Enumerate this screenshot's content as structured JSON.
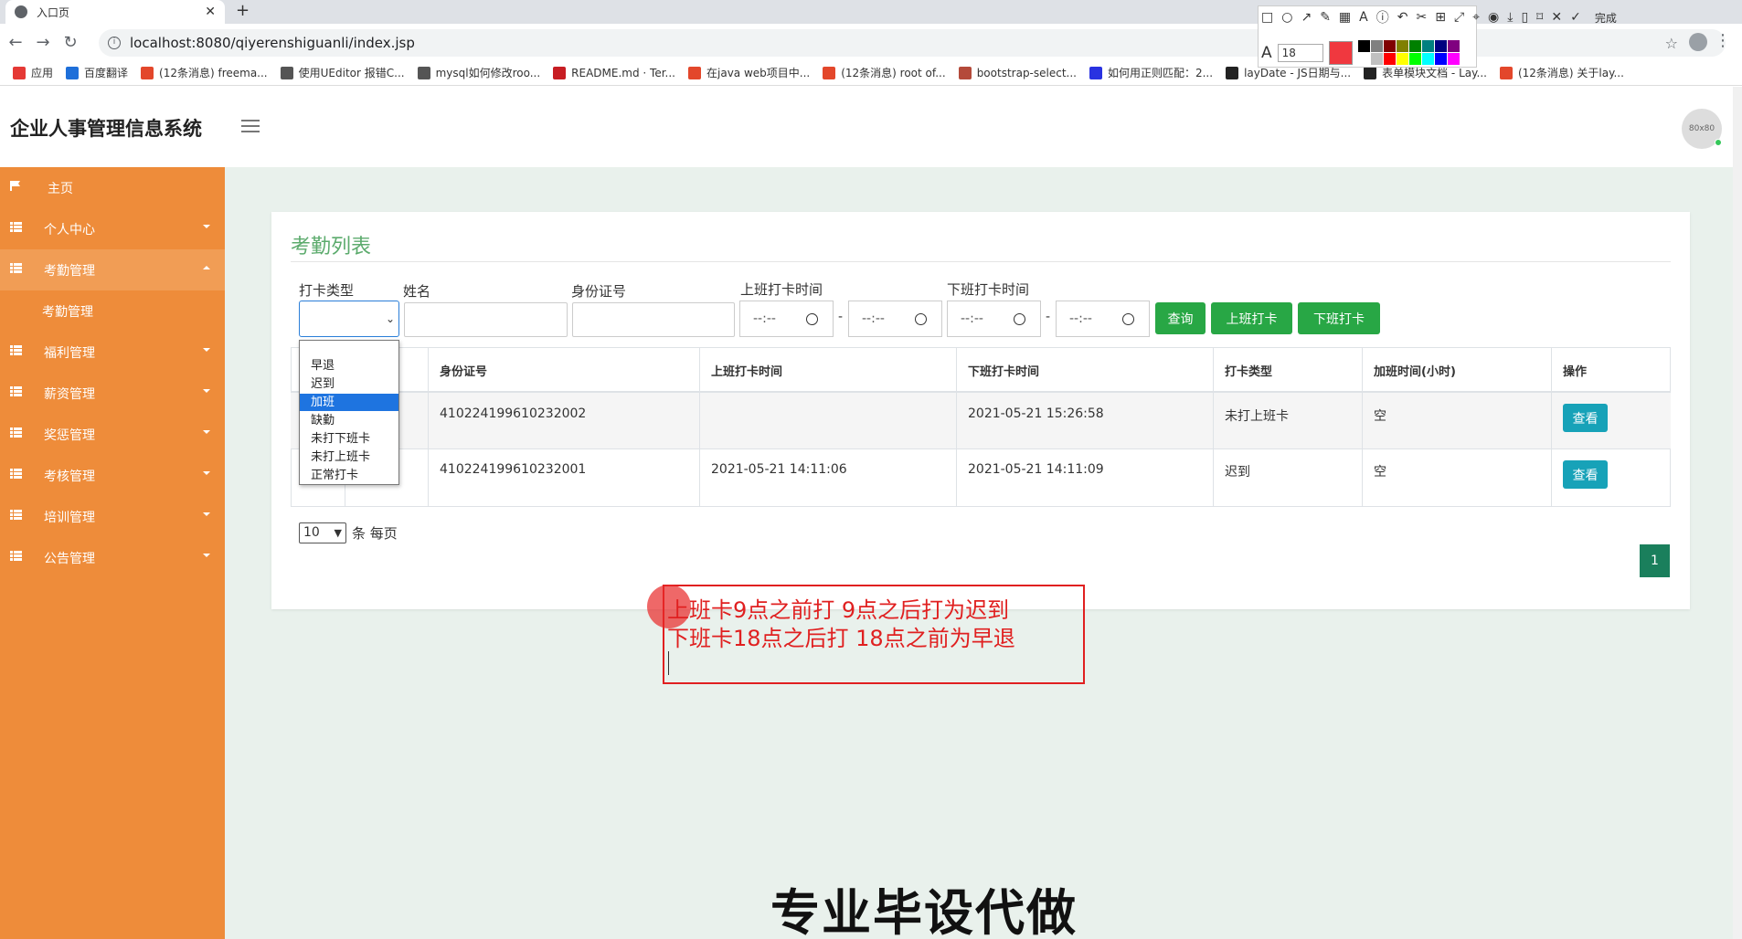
{
  "browser": {
    "tab_title": "入口页",
    "tab_close": "✕",
    "new_tab": "+",
    "url": "localhost:8080/qiyerenshiguanli/index.jsp",
    "bookmarks": [
      {
        "label": "应用",
        "color": "#e53935"
      },
      {
        "label": "百度翻译",
        "color": "#1e6fd9"
      },
      {
        "label": "(12条消息) freema...",
        "color": "#e3472b"
      },
      {
        "label": "使用UEditor 报错C...",
        "color": "#555555"
      },
      {
        "label": "mysql如何修改roo...",
        "color": "#555555"
      },
      {
        "label": "README.md · Ter...",
        "color": "#c71d23"
      },
      {
        "label": "在java web项目中...",
        "color": "#e3472b"
      },
      {
        "label": "(12条消息) root of...",
        "color": "#e3472b"
      },
      {
        "label": "bootstrap-select...",
        "color": "#b44a3a"
      },
      {
        "label": "如何用正则匹配：2...",
        "color": "#2932e1"
      },
      {
        "label": "layDate - JS日期与...",
        "color": "#222222"
      },
      {
        "label": "表单模块文档 - Lay...",
        "color": "#222222"
      },
      {
        "label": "(12条消息) 关于lay...",
        "color": "#e3472b"
      }
    ]
  },
  "screenshot_tool": {
    "font_size": "18",
    "done_label": "完成",
    "current_color": "#f0383f",
    "palette": [
      "#000000",
      "#808080",
      "#800000",
      "#808000",
      "#008000",
      "#008080",
      "#000080",
      "#800080",
      "#ffffff",
      "#c0c0c0",
      "#ff0000",
      "#ffff00",
      "#00ff00",
      "#00ffff",
      "#0000ff",
      "#ff00ff"
    ]
  },
  "header": {
    "brand": "企业人事管理信息系统",
    "avatar_text": "80x80"
  },
  "sidebar": {
    "items": [
      {
        "label": "主页"
      },
      {
        "label": "个人中心"
      },
      {
        "label": "考勤管理"
      },
      {
        "label": "福利管理"
      },
      {
        "label": "薪资管理"
      },
      {
        "label": "奖惩管理"
      },
      {
        "label": "考核管理"
      },
      {
        "label": "培训管理"
      },
      {
        "label": "公告管理"
      }
    ],
    "sub_item": "考勤管理"
  },
  "page": {
    "title": "考勤列表",
    "filters": {
      "type_label": "打卡类型",
      "name_label": "姓名",
      "id_label": "身份证号",
      "checkin_label": "上班打卡时间",
      "checkout_label": "下班打卡时间",
      "time_placeholder": "--:--",
      "range_sep": "-"
    },
    "buttons": {
      "query": "查询",
      "checkin": "上班打卡",
      "checkout": "下班打卡"
    },
    "dropdown_options": [
      "早退",
      "迟到",
      "加班",
      "缺勤",
      "未打下班卡",
      "未打上班卡",
      "正常打卡"
    ],
    "dropdown_highlight": "加班",
    "table": {
      "columns": [
        "身份证号",
        "上班打卡时间",
        "下班打卡时间",
        "打卡类型",
        "加班时间(小时)",
        "操作"
      ],
      "rows": [
        {
          "id": "410224199610232002",
          "checkin": "",
          "checkout": "2021-05-21 15:26:58",
          "type": "未打上班卡",
          "overtime": "空",
          "action": "查看"
        },
        {
          "id": "410224199610232001",
          "checkin": "2021-05-21 14:11:06",
          "checkout": "2021-05-21 14:11:09",
          "type": "迟到",
          "overtime": "空",
          "action": "查看"
        }
      ]
    },
    "page_size": "10",
    "page_size_suffix": "条 每页",
    "current_page": "1"
  },
  "annotation": {
    "line1": "上班卡9点之前打 9点之后打为迟到",
    "line2": "下班卡18点之后打 18点之前为早退"
  },
  "watermark": "专业毕设代做"
}
